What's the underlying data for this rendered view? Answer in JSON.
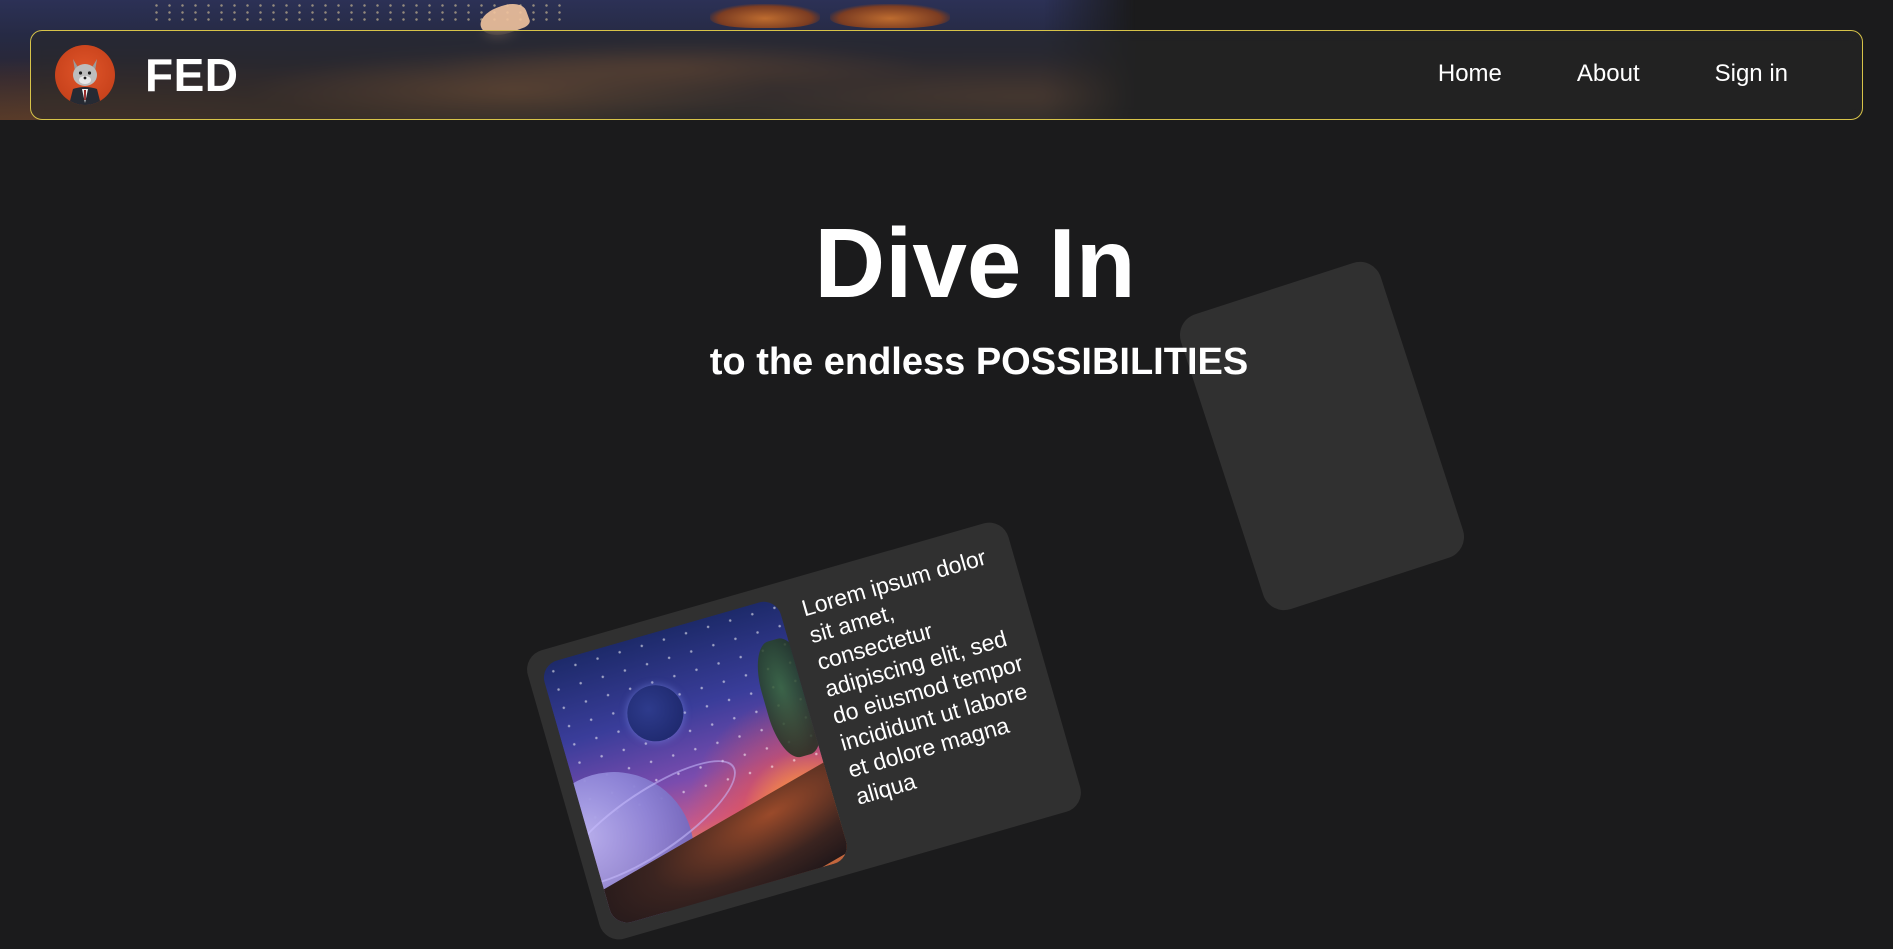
{
  "header": {
    "brand": "FED",
    "avatar_icon": "wolf-avatar-icon",
    "nav": [
      {
        "label": "Home"
      },
      {
        "label": "About"
      },
      {
        "label": "Sign in"
      }
    ],
    "border_color": "#d7c349"
  },
  "hero": {
    "title": "Dive In",
    "subtitle": "to the endless POSSIBILITIES"
  },
  "feature_card": {
    "text": "Lorem ipsum dolor sit amet, consectetur adipiscing elit, sed do eiusmod tempor incididunt ut labore et dolore magna aliqua"
  },
  "colors": {
    "background": "#1b1b1c",
    "card": "#303030",
    "text": "#ffffff"
  }
}
